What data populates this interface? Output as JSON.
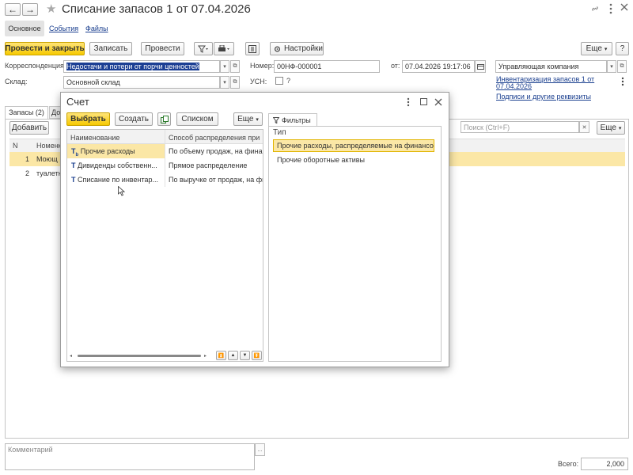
{
  "window": {
    "title": "Списание запасов 1 от 07.04.2026"
  },
  "nav": {
    "back_glyph": "←",
    "forward_glyph": "→",
    "star_glyph": "★"
  },
  "section_tabs": [
    {
      "label": "Основное"
    },
    {
      "label": "События"
    },
    {
      "label": "Файлы"
    }
  ],
  "toolbar": {
    "post_close": "Провести и закрыть",
    "save": "Записать",
    "post": "Провести",
    "settings": "Настройки",
    "more": "Еще"
  },
  "form": {
    "corr_label": "Корреспонденция:",
    "corr_value": "Недостачи и потери от порчи ценностей",
    "warehouse_label": "Склад:",
    "warehouse_value": "Основной склад",
    "number_label": "Номер:",
    "number_value": "00НФ-000001",
    "from_label": "от:",
    "date_value": "07.04.2026 19:17:06",
    "usn_label": "УСН:",
    "usn_help": "?",
    "org_value": "Управляющая компания",
    "inventory_link_1": "Инвентаризация запасов 1 от",
    "inventory_link_2": "07.04.2026",
    "signatures_link": "Подписи и другие реквизиты"
  },
  "doc_tabs": [
    {
      "label": "Запасы (2)"
    },
    {
      "label": "До"
    }
  ],
  "bg_table": {
    "add_button": "Добавить",
    "search_placeholder": "Поиск (Ctrl+F)",
    "more": "Еще",
    "col_n": "N",
    "col_name": "Номенк",
    "rows": [
      {
        "n": "1",
        "name": "Моющ"
      },
      {
        "n": "2",
        "name": "туалетн"
      }
    ]
  },
  "footer": {
    "comment_placeholder": "Комментарий",
    "comment_btn": "...",
    "total_label": "Всего:",
    "total_value": "2,000"
  },
  "dialog": {
    "title": "Счет",
    "select": "Выбрать",
    "create": "Создать",
    "list": "Списком",
    "more": "Еще",
    "filters_tab": "Фильтры",
    "col_name": "Наименование",
    "col_method": "Способ распределения при за",
    "rows": [
      {
        "name": "Прочие расходы",
        "method": "По объему продаж, на финансо"
      },
      {
        "name": "Дивиденды собственн...",
        "method": "Прямое распределение"
      },
      {
        "name": "Списание по инвентар...",
        "method": "По выручке от продаж, на фина"
      }
    ],
    "filter_header": "Тип",
    "filter_items": [
      {
        "label": "Прочие расходы, распределяемые на финансо..."
      },
      {
        "label": "Прочие оборотные активы"
      }
    ]
  },
  "colors": {
    "accent_yellow": "#f6c900",
    "selected_row": "#fbe7a6",
    "link": "#1a3f8f"
  }
}
